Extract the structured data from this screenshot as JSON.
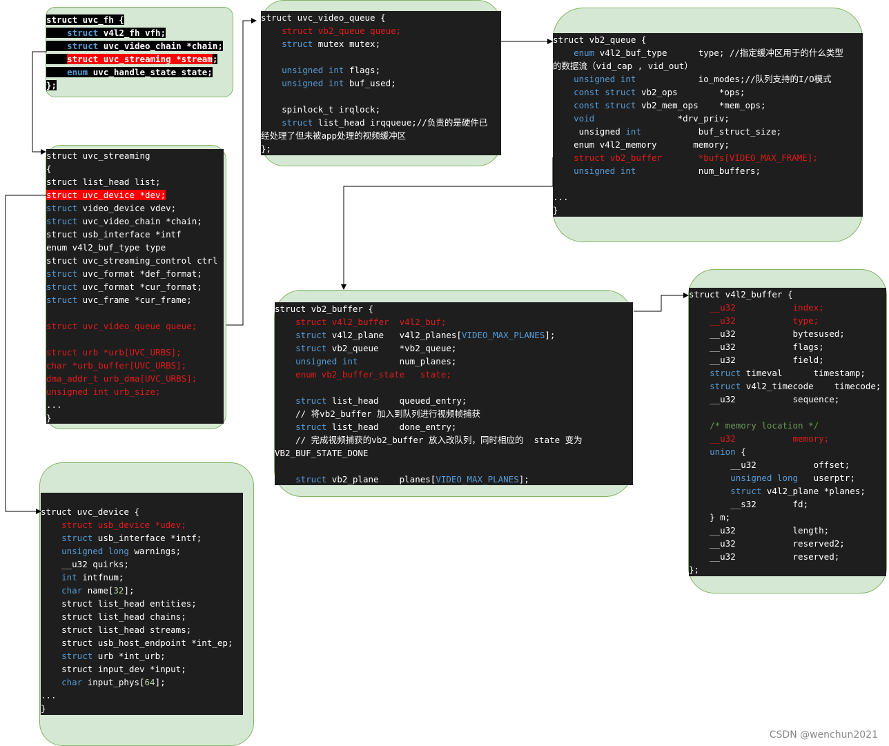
{
  "structs": [
    {
      "id": "uvc_fh",
      "lines": [
        [
          {
            "t": "struct uvc_fh {"
          }
        ],
        [
          {
            "t": "    "
          },
          {
            "t": "struct",
            "c": "kw"
          },
          {
            "t": " v4l2_fh vfh;"
          }
        ],
        [
          {
            "t": "    "
          },
          {
            "t": "struct",
            "c": "kw"
          },
          {
            "t": " uvc_video_chain *chain;"
          }
        ],
        [
          {
            "t": "    "
          },
          {
            "t": "struct",
            "c": "hl"
          },
          {
            "t": " uvc_streaming *stream",
            "c": "hl"
          },
          {
            "t": ";"
          }
        ],
        [
          {
            "t": "    "
          },
          {
            "t": "enum",
            "c": "kw"
          },
          {
            "t": " uvc_handle_state state;"
          }
        ],
        [
          {
            "t": "};"
          }
        ]
      ]
    },
    {
      "id": "uvc_streaming",
      "lines": [
        [
          {
            "t": "struct uvc_streaming"
          }
        ],
        [
          {
            "t": "{"
          }
        ],
        [
          {
            "t": "struct list_head list;"
          }
        ],
        [
          {
            "t": "struct uvc_device *dev;",
            "c": "hl"
          }
        ],
        [
          {
            "t": "struct",
            "c": "kw"
          },
          {
            "t": " video_device vdev;"
          }
        ],
        [
          {
            "t": "struct",
            "c": "kw"
          },
          {
            "t": " uvc_video_chain *chain;"
          }
        ],
        [
          {
            "t": "struct usb_interface *intf"
          }
        ],
        [
          {
            "t": "enum v4l2_buf_type type"
          }
        ],
        [
          {
            "t": "struct uvc_streaming_control ctrl"
          }
        ],
        [
          {
            "t": "struct",
            "c": "kw"
          },
          {
            "t": " uvc_format *def_format;"
          }
        ],
        [
          {
            "t": "struct",
            "c": "kw"
          },
          {
            "t": " uvc_format *cur_format;"
          }
        ],
        [
          {
            "t": "struct",
            "c": "kw"
          },
          {
            "t": " uvc_frame *cur_frame;"
          }
        ],
        [
          {
            "t": ""
          }
        ],
        [
          {
            "t": "struct uvc_video_queue queue;",
            "c": "red"
          }
        ],
        [
          {
            "t": ""
          }
        ],
        [
          {
            "t": "struct urb *urb[UVC_URBS];",
            "c": "red"
          }
        ],
        [
          {
            "t": "char *urb_buffer[UVC_URBS];",
            "c": "red"
          }
        ],
        [
          {
            "t": "dma_addr_t urb_dma[UVC_URBS];",
            "c": "red"
          }
        ],
        [
          {
            "t": "unsigned int urb_size;",
            "c": "red"
          }
        ],
        [
          {
            "t": "..."
          }
        ],
        [
          {
            "t": "}"
          }
        ]
      ]
    },
    {
      "id": "uvc_device",
      "lines": [
        [
          {
            "t": "struct uvc_device {"
          }
        ],
        [
          {
            "t": "    "
          },
          {
            "t": "struct usb_device *udev;",
            "c": "red"
          }
        ],
        [
          {
            "t": "    "
          },
          {
            "t": "struct",
            "c": "kw"
          },
          {
            "t": " usb_interface *intf;"
          }
        ],
        [
          {
            "t": "    "
          },
          {
            "t": "unsigned long",
            "c": "kw"
          },
          {
            "t": " warnings;"
          }
        ],
        [
          {
            "t": "    __u32 quirks;"
          }
        ],
        [
          {
            "t": "    "
          },
          {
            "t": "int",
            "c": "kw"
          },
          {
            "t": " intfnum;"
          }
        ],
        [
          {
            "t": "    "
          },
          {
            "t": "char",
            "c": "kw"
          },
          {
            "t": " name["
          },
          {
            "t": "32",
            "c": "num"
          },
          {
            "t": "];"
          }
        ],
        [
          {
            "t": "    struct list_head entities;"
          }
        ],
        [
          {
            "t": "    struct list_head chains;"
          }
        ],
        [
          {
            "t": "    struct list_head streams;"
          }
        ],
        [
          {
            "t": "    struct usb_host_endpoint *int_ep;"
          }
        ],
        [
          {
            "t": "    "
          },
          {
            "t": "struct",
            "c": "kw"
          },
          {
            "t": " urb *int_urb;"
          }
        ],
        [
          {
            "t": "    struct input_dev *input;"
          }
        ],
        [
          {
            "t": "    "
          },
          {
            "t": "char",
            "c": "kw"
          },
          {
            "t": " input_phys["
          },
          {
            "t": "64",
            "c": "num"
          },
          {
            "t": "];"
          }
        ],
        [
          {
            "t": "..."
          }
        ],
        [
          {
            "t": "}"
          }
        ]
      ]
    },
    {
      "id": "uvc_video_queue",
      "lines": [
        [
          {
            "t": "struct uvc_video_queue {"
          }
        ],
        [
          {
            "t": "    "
          },
          {
            "t": "struct vb2_queue queue;",
            "c": "red"
          }
        ],
        [
          {
            "t": "    "
          },
          {
            "t": "struct",
            "c": "kw"
          },
          {
            "t": " mutex mutex;"
          }
        ],
        [
          {
            "t": ""
          }
        ],
        [
          {
            "t": "    "
          },
          {
            "t": "unsigned int",
            "c": "kw"
          },
          {
            "t": " flags;"
          }
        ],
        [
          {
            "t": "    "
          },
          {
            "t": "unsigned int",
            "c": "kw"
          },
          {
            "t": " buf_used;"
          }
        ],
        [
          {
            "t": ""
          }
        ],
        [
          {
            "t": "    spinlock_t irqlock;"
          }
        ],
        [
          {
            "t": "    "
          },
          {
            "t": "struct",
            "c": "kw"
          },
          {
            "t": " list_head irqqueue;//负责的是硬件已"
          }
        ],
        [
          {
            "t": "经处理了但未被app处理的视频缓冲区"
          }
        ],
        [
          {
            "t": "};"
          }
        ]
      ]
    },
    {
      "id": "vb2_queue",
      "lines": [
        [
          {
            "t": "struct vb2_queue {"
          }
        ],
        [
          {
            "t": "    "
          },
          {
            "t": "enum",
            "c": "kw"
          },
          {
            "t": " v4l2_buf_type      type; //指定缓冲区用于的什么类型"
          }
        ],
        [
          {
            "t": "的数据流（vid_cap , vid_out）"
          }
        ],
        [
          {
            "t": "    "
          },
          {
            "t": "unsigned int",
            "c": "kw"
          },
          {
            "t": "            io_modes;//队列支持的I/O模式"
          }
        ],
        [
          {
            "t": "    "
          },
          {
            "t": "const struct",
            "c": "kw"
          },
          {
            "t": " vb2_ops        *ops;"
          }
        ],
        [
          {
            "t": "    "
          },
          {
            "t": "const struct",
            "c": "kw"
          },
          {
            "t": " vb2_mem_ops    *mem_ops;"
          }
        ],
        [
          {
            "t": "    "
          },
          {
            "t": "void",
            "c": "kw"
          },
          {
            "t": "                *drv_priv;"
          }
        ],
        [
          {
            "t": "     unsigned "
          },
          {
            "t": "int",
            "c": "kw"
          },
          {
            "t": "           buf_struct_size;"
          }
        ],
        [
          {
            "t": "    enum v4l2_memory       memory;"
          }
        ],
        [
          {
            "t": "    "
          },
          {
            "t": "struct vb2_buffer       *bufs[VIDEO_MAX_FRAME];",
            "c": "red"
          }
        ],
        [
          {
            "t": "    "
          },
          {
            "t": "unsigned int",
            "c": "kw"
          },
          {
            "t": "            num_buffers;"
          }
        ],
        [
          {
            "t": ""
          }
        ],
        [
          {
            "t": "..."
          }
        ],
        [
          {
            "t": "}"
          }
        ]
      ]
    },
    {
      "id": "vb2_buffer",
      "lines": [
        [
          {
            "t": "struct vb2_buffer {"
          }
        ],
        [
          {
            "t": "    "
          },
          {
            "t": "struct v4l2_buffer  v4l2_buf;",
            "c": "red"
          }
        ],
        [
          {
            "t": "    "
          },
          {
            "t": "struct",
            "c": "kw"
          },
          {
            "t": " v4l2_plane   v4l2_planes["
          },
          {
            "t": "VIDEO_MAX_PLANES",
            "c": "kw"
          },
          {
            "t": "];"
          }
        ],
        [
          {
            "t": "    "
          },
          {
            "t": "struct",
            "c": "kw"
          },
          {
            "t": " vb2_queue    *vb2_queue;"
          }
        ],
        [
          {
            "t": "    "
          },
          {
            "t": "unsigned int",
            "c": "kw"
          },
          {
            "t": "        num_planes;"
          }
        ],
        [
          {
            "t": "    "
          },
          {
            "t": "enum vb2_buffer_state   state;",
            "c": "red"
          }
        ],
        [
          {
            "t": ""
          }
        ],
        [
          {
            "t": "    "
          },
          {
            "t": "struct",
            "c": "kw"
          },
          {
            "t": " list_head    queued_entry;"
          }
        ],
        [
          {
            "t": "    // 将vb2_buffer 加入到队列进行视频帧捕获"
          }
        ],
        [
          {
            "t": "    "
          },
          {
            "t": "struct",
            "c": "kw"
          },
          {
            "t": " list_head    done_entry;"
          }
        ],
        [
          {
            "t": "    // 完成视频捕获的vb2_buffer 放入改队列，同时相应的  state 变为"
          }
        ],
        [
          {
            "t": "VB2_BUF_STATE_DONE"
          }
        ],
        [
          {
            "t": ""
          }
        ],
        [
          {
            "t": "    "
          },
          {
            "t": "struct",
            "c": "kw"
          },
          {
            "t": " vb2_plane    planes["
          },
          {
            "t": "VIDEO_MAX_PLANES",
            "c": "kw"
          },
          {
            "t": "];"
          }
        ]
      ]
    },
    {
      "id": "v4l2_buffer",
      "lines": [
        [
          {
            "t": "struct v4l2_buffer {"
          }
        ],
        [
          {
            "t": "    "
          },
          {
            "t": "__u32           index;",
            "c": "red"
          }
        ],
        [
          {
            "t": "    "
          },
          {
            "t": "__u32           type;",
            "c": "red"
          }
        ],
        [
          {
            "t": "    __u32           bytesused;"
          }
        ],
        [
          {
            "t": "    __u32           flags;"
          }
        ],
        [
          {
            "t": "    __u32           field;"
          }
        ],
        [
          {
            "t": "    "
          },
          {
            "t": "struct",
            "c": "kw"
          },
          {
            "t": " timeval      timestamp;"
          }
        ],
        [
          {
            "t": "    "
          },
          {
            "t": "struct",
            "c": "kw"
          },
          {
            "t": " v4l2_timecode    timecode;"
          }
        ],
        [
          {
            "t": "    __u32           sequence;"
          }
        ],
        [
          {
            "t": ""
          }
        ],
        [
          {
            "t": "    "
          },
          {
            "t": "/* memory location */",
            "c": "cmt"
          }
        ],
        [
          {
            "t": "    "
          },
          {
            "t": "__u32           memory;",
            "c": "red"
          }
        ],
        [
          {
            "t": "    "
          },
          {
            "t": "union",
            "c": "kw"
          },
          {
            "t": " {"
          }
        ],
        [
          {
            "t": "        __u32           offset;"
          }
        ],
        [
          {
            "t": "        "
          },
          {
            "t": "unsigned long",
            "c": "kw"
          },
          {
            "t": "   userptr;"
          }
        ],
        [
          {
            "t": "        "
          },
          {
            "t": "struct",
            "c": "kw"
          },
          {
            "t": " v4l2_plane *planes;"
          }
        ],
        [
          {
            "t": "        __s32       fd;"
          }
        ],
        [
          {
            "t": "    } m;"
          }
        ],
        [
          {
            "t": "    __u32           length;"
          }
        ],
        [
          {
            "t": "    __u32           reserved2;"
          }
        ],
        [
          {
            "t": "    __u32           reserved;"
          }
        ],
        [
          {
            "t": "};"
          }
        ]
      ]
    }
  ],
  "watermark": "CSDN @wenchun2021"
}
